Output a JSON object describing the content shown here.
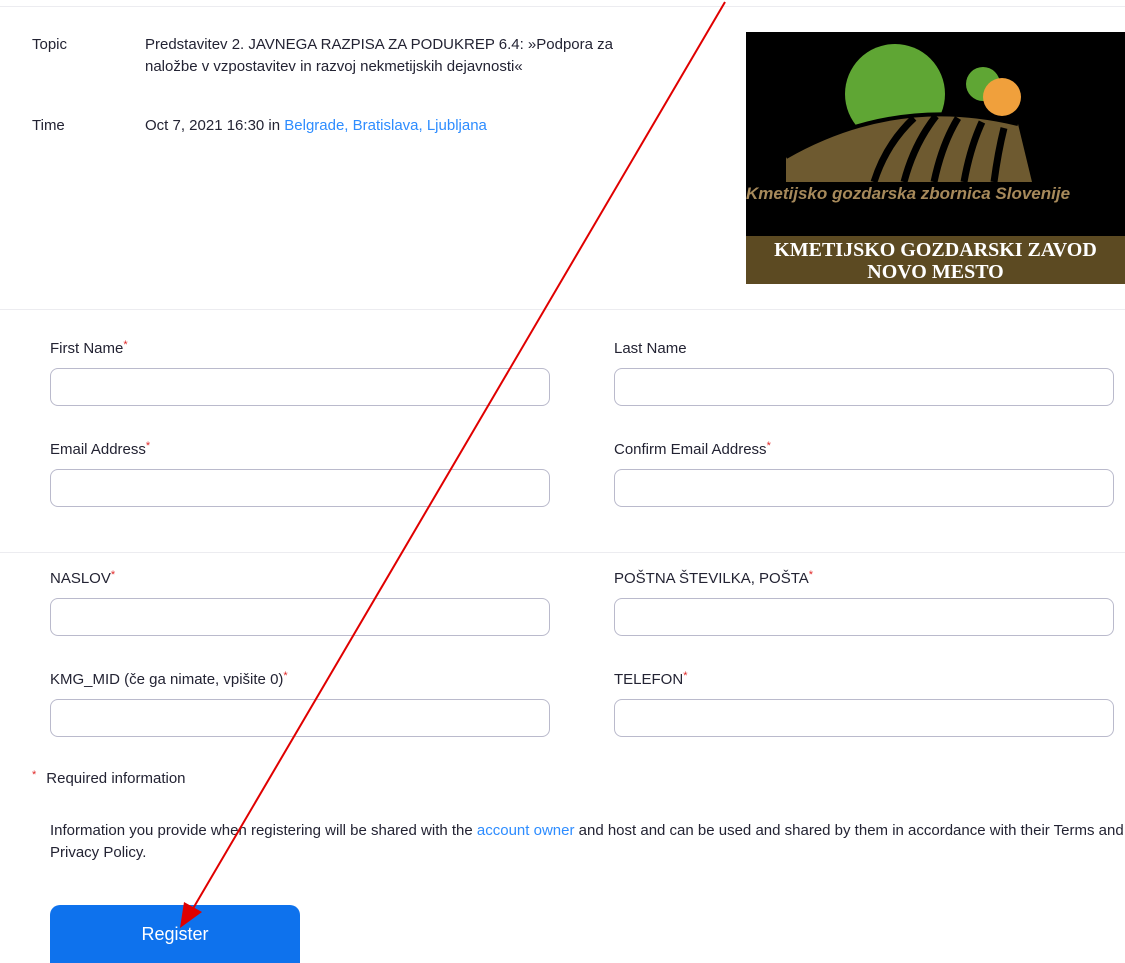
{
  "meeting": {
    "topic_label": "Topic",
    "topic_line1": "Predstavitev 2. JAVNEGA RAZPISA ZA PODUKREP 6.4: »Podpora za",
    "topic_line2": "naložbe v vzpostavitev in razvoj nekmetijskih dejavnosti«",
    "time_label": "Time",
    "time_value": "Oct 7, 2021 16:30 in ",
    "timezone_link": "Belgrade, Bratislava, Ljubljana"
  },
  "logo": {
    "motto": "Kmetijsko gozdarska zbornica Slovenije",
    "band_line1": "KMETIJSKO GOZDARSKI ZAVOD",
    "band_line2": "NOVO MESTO",
    "colors": {
      "green": "#5fa634",
      "orange": "#f0a03c",
      "brown": "#6e5a30",
      "band": "#5c4a22"
    }
  },
  "form": {
    "first_name_label": "First Name",
    "last_name_label": "Last Name",
    "email_label": "Email Address",
    "confirm_email_label": "Confirm Email Address",
    "naslov_label": "NASLOV",
    "postna_label": "POŠTNA ŠTEVILKA, POŠTA",
    "kmg_label": "KMG_MID (če ga nimate, vpišite 0)",
    "telefon_label": "TELEFON",
    "required_marker": "*",
    "values": {
      "first_name": "",
      "last_name": "",
      "email": "",
      "confirm_email": "",
      "naslov": "",
      "postna": "",
      "kmg_mid": "",
      "telefon": ""
    }
  },
  "footer": {
    "required_note": "Required information",
    "disclaimer_part1": "Information you provide when registering will be shared with the ",
    "account_owner_link": "account owner",
    "disclaimer_part2": " and host and can be used and shared by them in accordance with their Terms and Privacy Policy.",
    "register_label": "Register"
  },
  "colors": {
    "link": "#2d8cff",
    "button": "#0e72ed",
    "required": "#e02828",
    "arrow": "#e00000"
  }
}
